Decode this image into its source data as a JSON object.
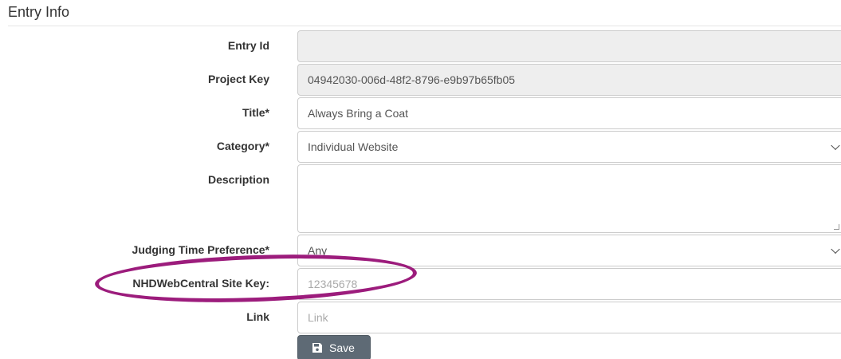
{
  "section": {
    "legend": "Entry Info"
  },
  "form": {
    "entry_id": {
      "label": "Entry Id",
      "value": ""
    },
    "project_key": {
      "label": "Project Key",
      "value": "04942030-006d-48f2-8796-e9b97b65fb05"
    },
    "title": {
      "label": "Title*",
      "value": "Always Bring a Coat"
    },
    "category": {
      "label": "Category*",
      "value": "Individual Website"
    },
    "description": {
      "label": "Description",
      "value": ""
    },
    "judging_time": {
      "label": "Judging Time Preference*",
      "value": "Any"
    },
    "site_key": {
      "label": "NHDWebCentral Site Key:",
      "placeholder": "12345678"
    },
    "link": {
      "label": "Link",
      "placeholder": "Link"
    }
  },
  "actions": {
    "save_label": "Save",
    "save_icon": "floppy-disk-icon"
  },
  "annotation": {
    "ellipse_color": "#9c1c7c"
  }
}
